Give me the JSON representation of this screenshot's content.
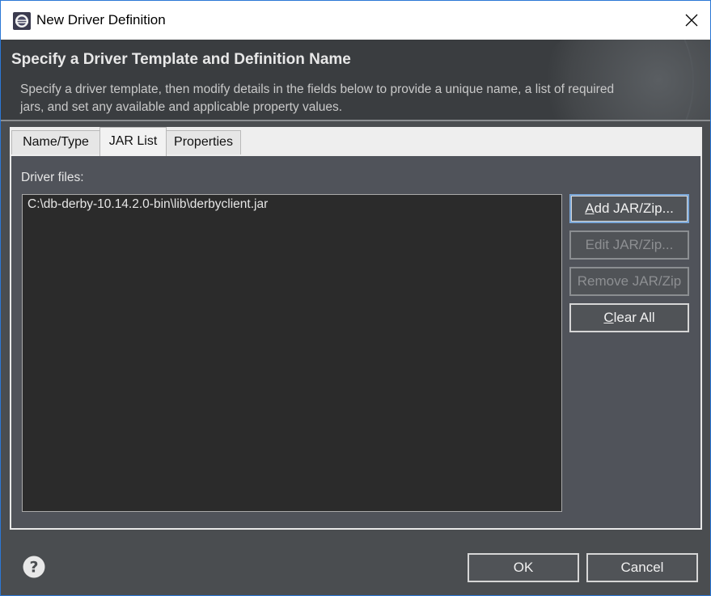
{
  "window": {
    "title": "New Driver Definition",
    "icons": {
      "app": "eclipse-app-icon",
      "close": "close-icon",
      "help": "help-icon"
    }
  },
  "banner": {
    "title": "Specify a Driver Template and Definition Name",
    "description": "Specify a driver template, then modify details in the fields below to provide a unique name, a list of required jars, and set any available and applicable property values."
  },
  "tabs": [
    {
      "label": "Name/Type",
      "active": false
    },
    {
      "label": "JAR List",
      "active": true
    },
    {
      "label": "Properties",
      "active": false
    }
  ],
  "jar_list": {
    "label": "Driver files:",
    "files": [
      "C:\\db-derby-10.14.2.0-bin\\lib\\derbyclient.jar"
    ]
  },
  "buttons": {
    "add": {
      "mnemonic": "A",
      "rest": "dd JAR/Zip...",
      "enabled": true
    },
    "edit": {
      "label": "Edit JAR/Zip...",
      "enabled": false
    },
    "remove": {
      "label": "Remove JAR/Zip",
      "enabled": false
    },
    "clear": {
      "mnemonic": "C",
      "rest": "lear All",
      "enabled": true
    }
  },
  "footer": {
    "ok": "OK",
    "cancel": "Cancel"
  },
  "colors": {
    "dialog_bg": "#4a4d50",
    "banner_bg": "#3a3d40",
    "list_bg": "#2b2b2b",
    "accent_border": "#2b78d6"
  }
}
